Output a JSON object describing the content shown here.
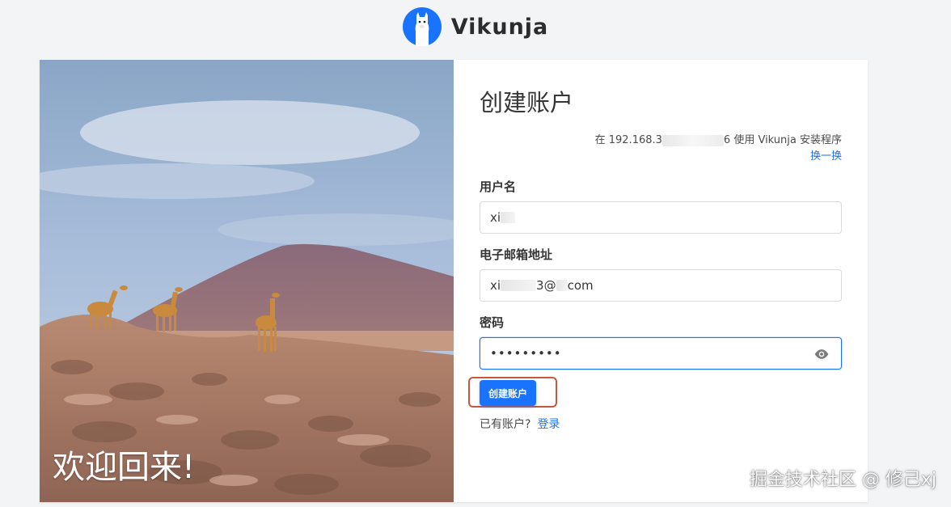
{
  "app": {
    "name": "Vikunja"
  },
  "hero": {
    "welcome_text": "欢迎回来!"
  },
  "form": {
    "title": "创建账户",
    "server_prefix": "在 192.168.3",
    "server_suffix": "6 使用 Vikunja 安装程序",
    "change_server_label": "换一换",
    "username_label": "用户名",
    "username_value": "xi",
    "email_label": "电子邮箱地址",
    "email_value_prefix": "xi",
    "email_value_mid": "3@",
    "email_value_suffix": "com",
    "password_label": "密码",
    "password_value": "•••••••••",
    "submit_label": "创建账户",
    "have_account_text": "已有账户?",
    "login_link_label": "登录"
  },
  "watermark": {
    "text": "掘金技术社区 @ 修己xj"
  },
  "colors": {
    "accent": "#1973ff",
    "highlight_box": "#c8573c",
    "background": "#f3f4f6"
  }
}
